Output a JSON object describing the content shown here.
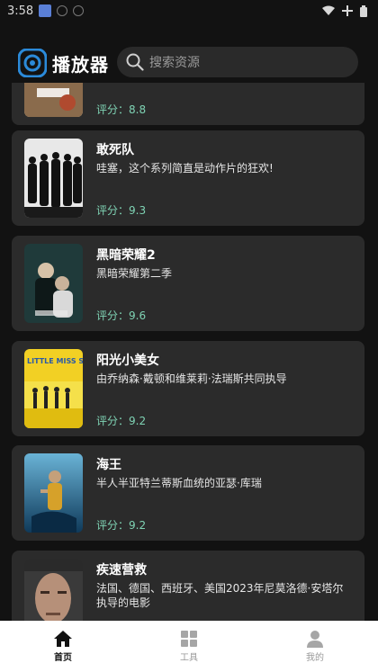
{
  "status_bar": {
    "time": "3:58"
  },
  "header": {
    "app_title": "播放器",
    "search_placeholder": "搜索资源"
  },
  "movies": [
    {
      "title": "",
      "description": "",
      "score_label": "评分：8.8"
    },
    {
      "title": "敢死队",
      "description": "哇塞，这个系列简直是动作片的狂欢!",
      "score_label": "评分：9.3"
    },
    {
      "title": "黑暗荣耀2",
      "description": "黑暗荣耀第二季",
      "score_label": "评分：9.6"
    },
    {
      "title": "阳光小美女",
      "description": "由乔纳森·戴顿和维莱莉·法瑞斯共同执导",
      "score_label": "评分：9.2",
      "poster_text": "LITTLE MISS SU"
    },
    {
      "title": "海王",
      "description": "半人半亚特兰蒂斯血统的亚瑟·库瑞",
      "score_label": "评分：9.2"
    },
    {
      "title": "疾速营救",
      "description": "法国、德国、西班牙、美国2023年尼莫洛德·安塔尔执导的电影",
      "score_label": ""
    }
  ],
  "bottom_nav": [
    {
      "label": "首页",
      "icon": "home-icon",
      "active": true
    },
    {
      "label": "工具",
      "icon": "tools-icon",
      "active": false
    },
    {
      "label": "我的",
      "icon": "user-icon",
      "active": false
    }
  ],
  "colors": {
    "accent": "#2b8ad9",
    "score": "#7fd3b4",
    "card": "#2b2b2b",
    "background": "#121212"
  }
}
